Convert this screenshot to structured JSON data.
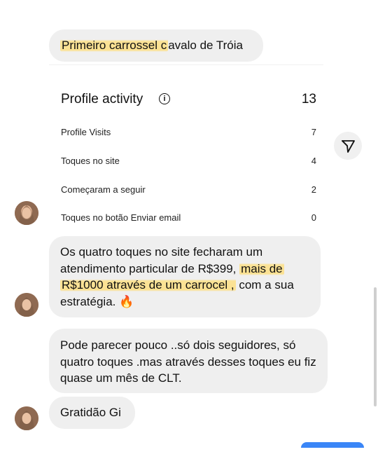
{
  "messages": {
    "first": {
      "highlight": "Primeiro carrossel c",
      "rest": "avalo de Tróia"
    },
    "second": {
      "part1": "Os quatro toques no site fecharam um atendimento particular de R$399, ",
      "highlight1": "mais de",
      "highlight2": "R$1000 através de um carrocel ,",
      "part2": " com a sua estratégia. 🔥"
    },
    "third": "Pode parecer pouco ..só dois seguidores, só quatro toques .mas através desses toques eu fiz quase um mês de CLT.",
    "fourth": "Gratidão Gi"
  },
  "profile_activity": {
    "title": "Profile activity",
    "total": "13",
    "rows": [
      {
        "label": "Profile Visits",
        "value": "7"
      },
      {
        "label": "Toques no site",
        "value": "4"
      },
      {
        "label": "Começaram a seguir",
        "value": "2"
      },
      {
        "label": "Toques no botão Enviar email",
        "value": "0"
      }
    ]
  },
  "icons": {
    "info": "info-icon",
    "send": "send-icon",
    "avatar": "avatar"
  },
  "colors": {
    "bubble": "#efefef",
    "highlight": "#ffde78",
    "accent": "#3a86f7"
  }
}
